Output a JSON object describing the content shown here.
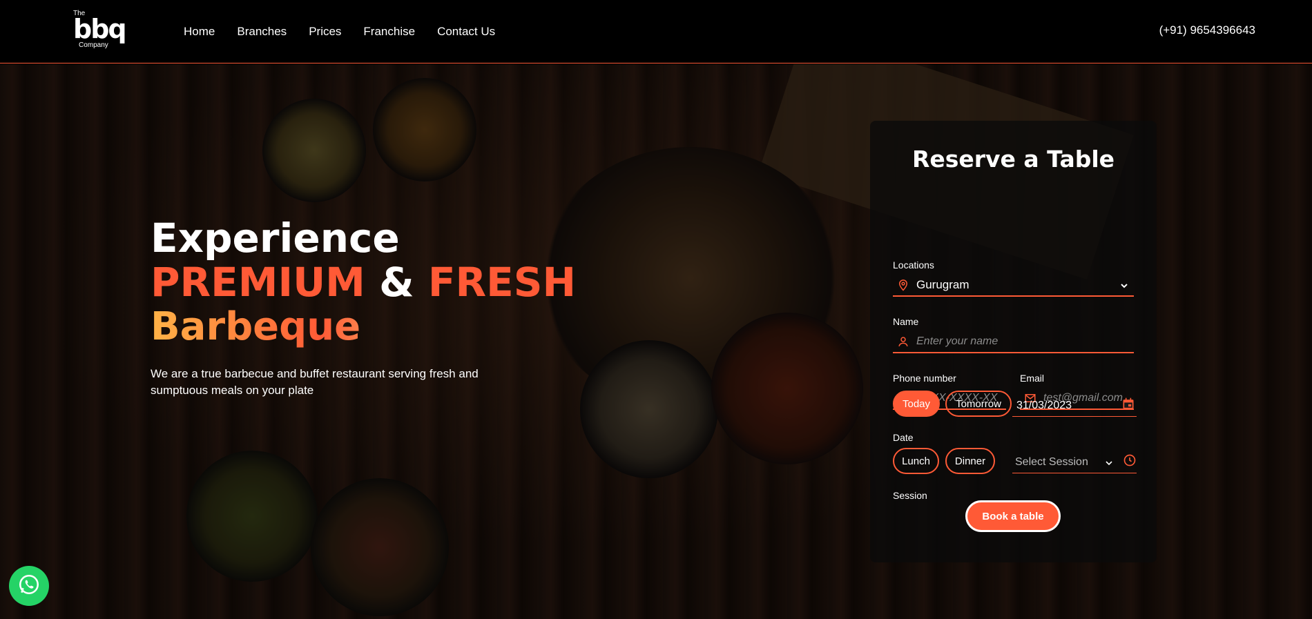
{
  "header": {
    "logo": {
      "the": "The",
      "mark": "bbq",
      "company": "Company"
    },
    "nav": [
      {
        "label": "Home"
      },
      {
        "label": "Branches"
      },
      {
        "label": "Prices"
      },
      {
        "label": "Franchise"
      },
      {
        "label": "Contact Us"
      }
    ],
    "phone": "(+91) 9654396643"
  },
  "hero": {
    "line1": "Experience",
    "line2_a": "PREMIUM",
    "line2_b": " & ",
    "line2_c": "FRESH",
    "line3": "Barbeque",
    "subtitle": "We are a true barbecue and buffet restaurant serving fresh and sumptuous meals on your plate"
  },
  "reserve": {
    "title": "Reserve a Table",
    "location_label": "Locations",
    "location_value": "Gurugram",
    "name_label": "Name",
    "name_placeholder": "Enter your name",
    "phone_label": "Phone number",
    "phone_placeholder": "XXXX-XXXX-XX",
    "email_label": "Email",
    "email_placeholder": "test@gmail.com",
    "date_label": "Date",
    "today": "Today",
    "tomorrow": "Tomorrow",
    "date_value": "31/03/2023",
    "session_label": "Session",
    "lunch": "Lunch",
    "dinner": "Dinner",
    "session_placeholder": "Select Session",
    "book": "Book a table"
  },
  "colors": {
    "accent": "#ff5a36",
    "whatsapp": "#25d366"
  },
  "icons": [
    "location-pin-icon",
    "user-icon",
    "phone-icon",
    "mail-icon",
    "calendar-icon",
    "clock-icon",
    "chevron-down-icon",
    "whatsapp-icon"
  ]
}
